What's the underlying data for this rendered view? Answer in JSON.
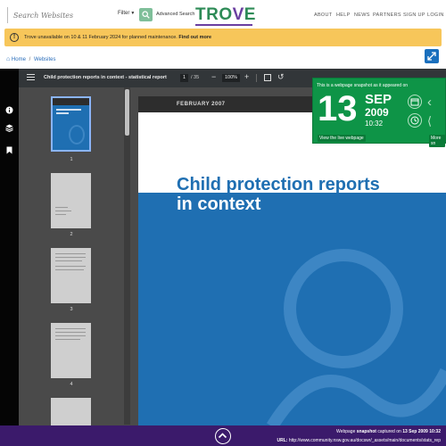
{
  "header": {
    "search_placeholder": "Search Websites",
    "filter_label": "Filter",
    "advanced_search": "Advanced Search",
    "logo": "TROVE",
    "nav": [
      "ABOUT",
      "HELP",
      "NEWS",
      "PARTNERS",
      "SIGN UP",
      "LOGIN"
    ]
  },
  "alert": {
    "text": "Trove unavailable on 10 & 11 February 2024 for planned maintenance.",
    "link": "Find out more"
  },
  "breadcrumb": {
    "home": "Home",
    "separator": "/",
    "current": "Websites"
  },
  "viewer": {
    "doc_title": "Child protection reports in context - statistical report",
    "page_current": "1",
    "page_total": "/ 35",
    "zoom": "100%",
    "zoom_minus": "−",
    "zoom_plus": "+",
    "thumbnails": [
      "1",
      "2",
      "3",
      "4"
    ],
    "page": {
      "date": "FEBRUARY 2007",
      "title_line1": "Child protection reports",
      "title_line2": "in context"
    }
  },
  "snapshot": {
    "header": "This is a webpage snapshot as it appeared on",
    "day": "13",
    "month": "SEP",
    "year": "2009",
    "time": "10:32",
    "live_link": "View the live webpage",
    "more_link": "More sn"
  },
  "footer": {
    "line1_prefix": "Webpage",
    "line1_bold": "snapshot",
    "line1_mid": "captured on",
    "line1_date": "13 Sep 2009 10:32",
    "line2_label": "URL:",
    "line2_url": "http://www.community.nsw.gov.au/docswr/_assets/main/documents/stats_rep"
  },
  "colors": {
    "brand_green": "#2e8b57",
    "brand_purple": "#3b1a6b",
    "alert_yellow": "#f7c65a",
    "snapshot_green": "#0e9447",
    "doc_blue": "#1f6fb2"
  }
}
